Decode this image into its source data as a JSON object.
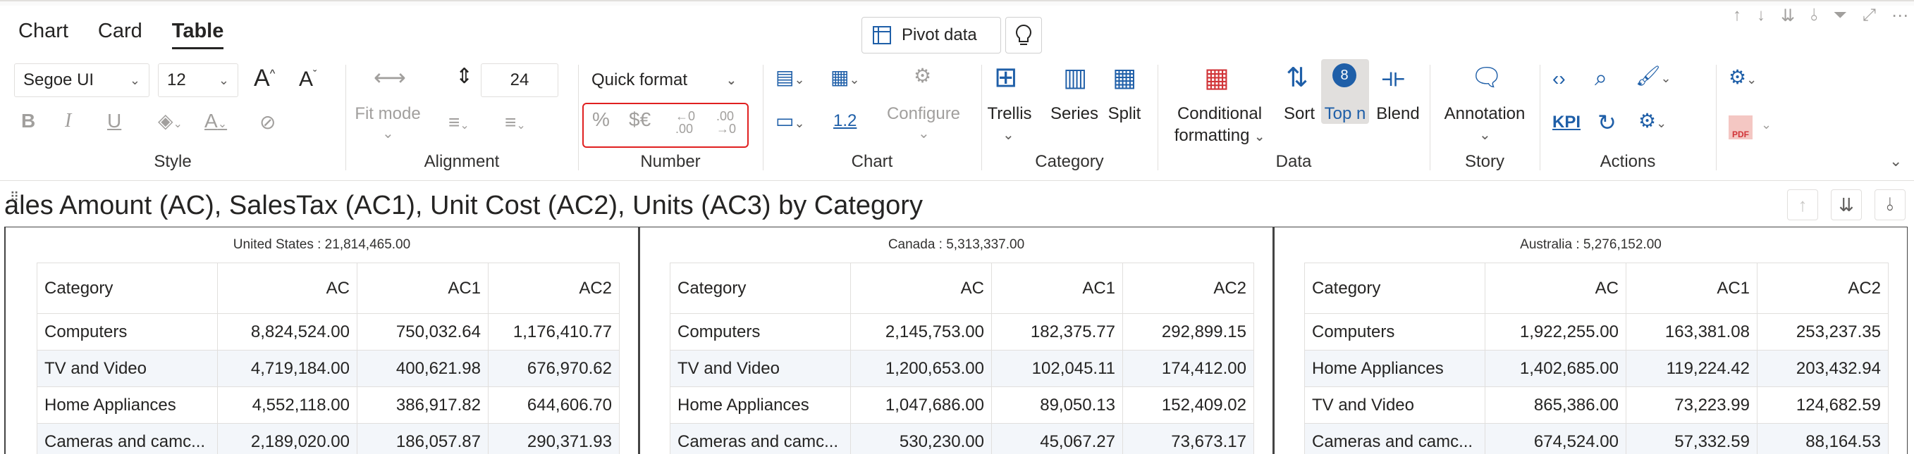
{
  "tabs": [
    {
      "label": "Chart",
      "active": false
    },
    {
      "label": "Card",
      "active": false
    },
    {
      "label": "Table",
      "active": true
    }
  ],
  "pivot_label": "Pivot data",
  "style": {
    "font_family": "Segoe UI",
    "font_size": "12",
    "label": "Style"
  },
  "alignment": {
    "fit_mode": "Fit mode",
    "line_height": "24",
    "label": "Alignment"
  },
  "number": {
    "quick_format": "Quick format",
    "label": "Number"
  },
  "chart_group": {
    "decimal_sample": "1.2",
    "configure": "Configure",
    "label": "Chart"
  },
  "category_group": {
    "trellis": "Trellis",
    "series": "Series",
    "split": "Split",
    "label": "Category"
  },
  "data_group": {
    "conditional": "Conditional",
    "formatting": "formatting",
    "sort": "Sort",
    "topn": "Top n",
    "topn_badge": "8",
    "blend": "Blend",
    "label": "Data"
  },
  "story_group": {
    "annotation": "Annotation",
    "label": "Story"
  },
  "actions_group": {
    "kpi": "KPI",
    "label": "Actions"
  },
  "export_pdf": "PDF",
  "visual_title": "ales Amount (AC), SalesTax (AC1), Unit Cost (AC2), Units (AC3) by Category",
  "colors": {
    "accent": "#1f5fa8",
    "highlight_border": "#e02020",
    "alt_row": "#f3f6fa"
  },
  "headers": [
    "Category",
    "AC",
    "AC1",
    "AC2"
  ],
  "panels": [
    {
      "title": "United States :  21,814,465.00",
      "rows": [
        [
          "Computers",
          "8,824,524.00",
          "750,032.64",
          "1,176,410.77"
        ],
        [
          "TV and Video",
          "4,719,184.00",
          "400,621.98",
          "676,970.62"
        ],
        [
          "Home Appliances",
          "4,552,118.00",
          "386,917.82",
          "644,606.70"
        ],
        [
          "Cameras and camc...",
          "2,189,020.00",
          "186,057.87",
          "290,371.93"
        ]
      ]
    },
    {
      "title": "Canada :  5,313,337.00",
      "rows": [
        [
          "Computers",
          "2,145,753.00",
          "182,375.77",
          "292,899.15"
        ],
        [
          "TV and Video",
          "1,200,653.00",
          "102,045.11",
          "174,412.00"
        ],
        [
          "Home Appliances",
          "1,047,686.00",
          "89,050.13",
          "152,409.02"
        ],
        [
          "Cameras and camc...",
          "530,230.00",
          "45,067.27",
          "73,673.17"
        ]
      ]
    },
    {
      "title": "Australia :  5,276,152.00",
      "rows": [
        [
          "Computers",
          "1,922,255.00",
          "163,381.08",
          "253,237.35"
        ],
        [
          "Home Appliances",
          "1,402,685.00",
          "119,224.42",
          "203,432.94"
        ],
        [
          "TV and Video",
          "865,386.00",
          "73,223.99",
          "124,682.59"
        ],
        [
          "Cameras and camc...",
          "674,524.00",
          "57,332.59",
          "88,164.53"
        ]
      ]
    }
  ]
}
